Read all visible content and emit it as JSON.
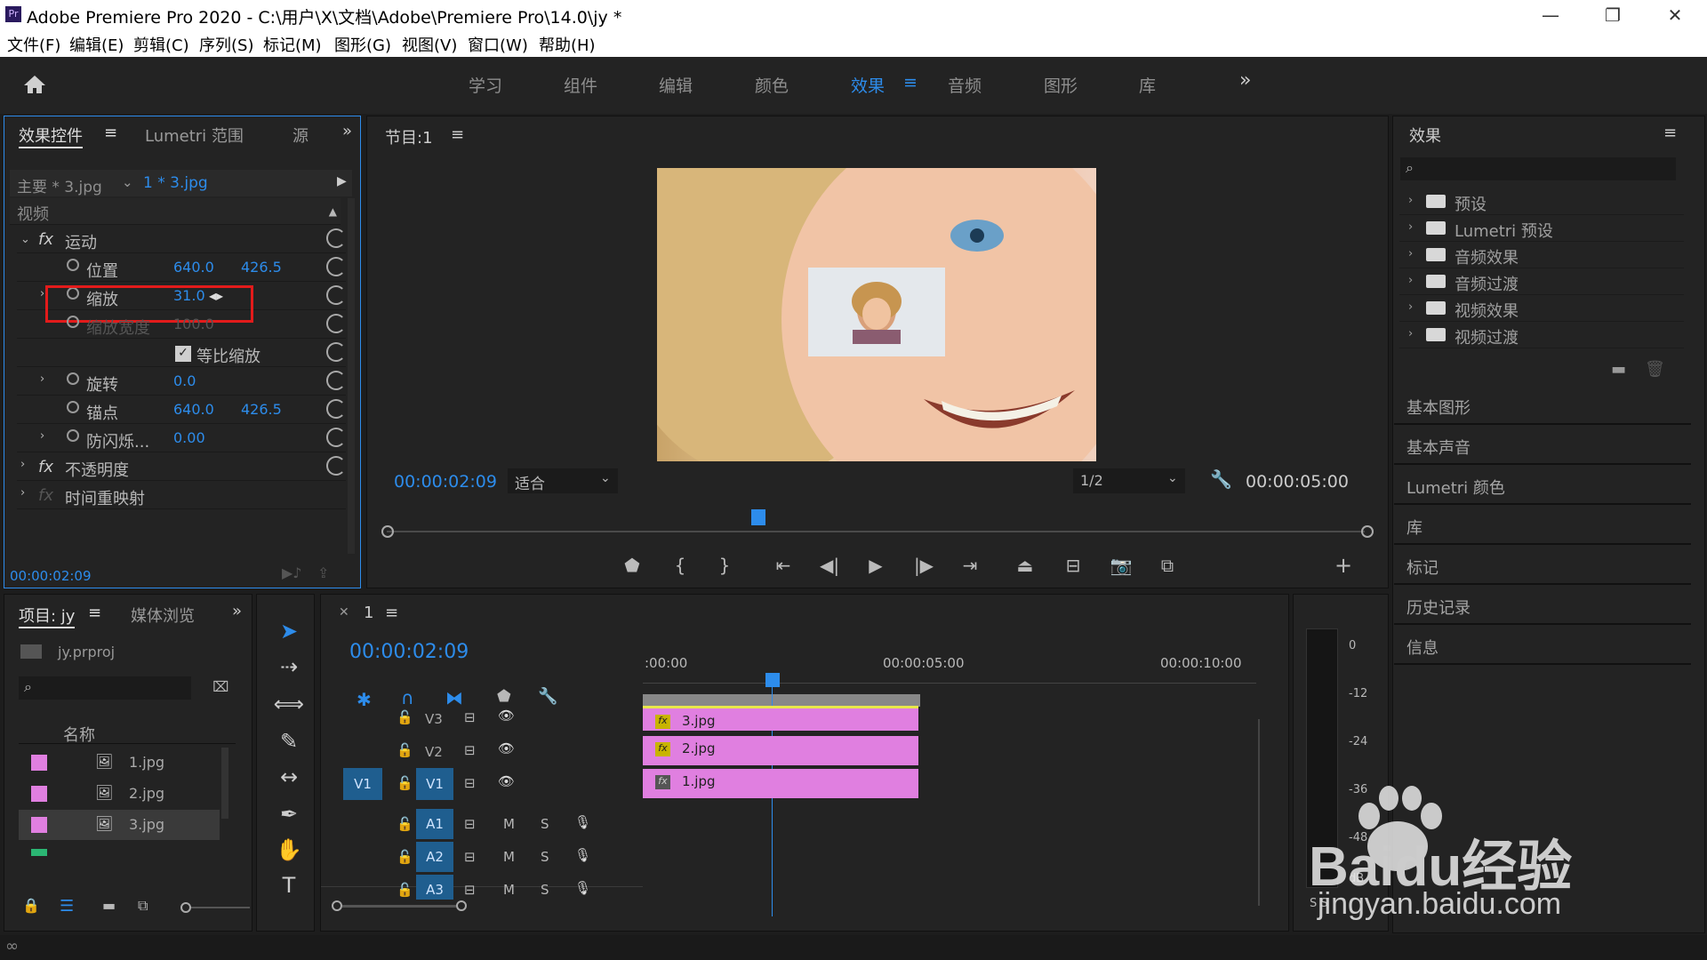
{
  "window": {
    "title": "Adobe Premiere Pro 2020 - C:\\用户\\X\\文档\\Adobe\\Premiere Pro\\14.0\\jy *",
    "minimize": "—",
    "restore": "❐",
    "close": "✕"
  },
  "menu": [
    "文件(F)",
    "编辑(E)",
    "剪辑(C)",
    "序列(S)",
    "标记(M)",
    "图形(G)",
    "视图(V)",
    "窗口(W)",
    "帮助(H)"
  ],
  "workspaces": {
    "items": [
      "学习",
      "组件",
      "编辑",
      "颜色",
      "效果",
      "音频",
      "图形",
      "库"
    ],
    "active": "效果",
    "more": "»"
  },
  "effect_controls": {
    "tabs": [
      "效果控件",
      "Lumetri 范围",
      "源"
    ],
    "source": "主要 * 3.jpg",
    "clip": "1 * 3.jpg",
    "section": "视频",
    "motion": "运动",
    "position_label": "位置",
    "position_x": "640.0",
    "position_y": "426.5",
    "scale_label": "缩放",
    "scale_value": "31.0",
    "scale_width_label": "缩放宽度",
    "scale_width_value": "100.0",
    "uniform_scale": "等比缩放",
    "rotation_label": "旋转",
    "rotation_value": "0.0",
    "anchor_label": "锚点",
    "anchor_x": "640.0",
    "anchor_y": "426.5",
    "antiflicker_label": "防闪烁...",
    "antiflicker_value": "0.00",
    "opacity": "不透明度",
    "time_remap": "时间重映射",
    "timecode": "00:00:02:09"
  },
  "program": {
    "title": "节目:1",
    "timecode": "00:00:02:09",
    "fit": "适合",
    "resolution": "1/2",
    "duration": "00:00:05:00"
  },
  "effects_panel": {
    "title": "效果",
    "items": [
      "预设",
      "Lumetri 预设",
      "音频效果",
      "音频过渡",
      "视频效果",
      "视频过渡"
    ],
    "sections": [
      "基本图形",
      "基本声音",
      "Lumetri 颜色",
      "库",
      "标记",
      "历史记录",
      "信息"
    ]
  },
  "project": {
    "tabs": [
      "项目: jy",
      "媒体浏览"
    ],
    "file": "jy.prproj",
    "column": "名称",
    "items": [
      "1.jpg",
      "2.jpg",
      "3.jpg"
    ]
  },
  "timeline": {
    "title": "1",
    "timecode": "00:00:02:09",
    "ruler": [
      ":00:00",
      "00:00:05:00",
      "00:00:10:00"
    ],
    "video_tracks": [
      "V3",
      "V2",
      "V1"
    ],
    "audio_tracks": [
      "A1",
      "A2",
      "A3"
    ],
    "source_patch": "V1",
    "mute": "M",
    "solo": "S",
    "clips": [
      "3.jpg",
      "2.jpg",
      "1.jpg"
    ]
  },
  "meter": {
    "ticks": [
      "0",
      "-12",
      "-24",
      "-36",
      "-48",
      "dB"
    ],
    "solo": "S S"
  },
  "watermark": {
    "brand": "Baidu经验",
    "url": "jingyan.baidu.com"
  }
}
